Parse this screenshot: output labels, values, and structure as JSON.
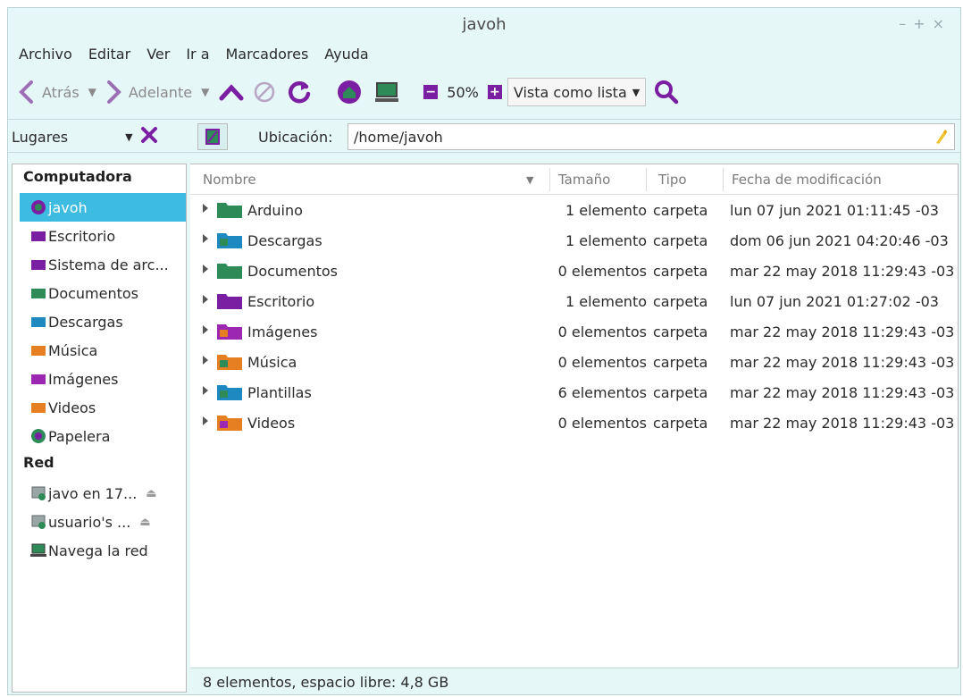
{
  "window": {
    "title": "javoh",
    "controls": [
      "–",
      "+",
      "×"
    ]
  },
  "menu": [
    "Archivo",
    "Editar",
    "Ver",
    "Ir a",
    "Marcadores",
    "Ayuda"
  ],
  "toolbar": {
    "back_label": "Atrás",
    "forward_label": "Adelante",
    "zoom_level": "50%",
    "view_mode": "Vista como lista"
  },
  "location": {
    "places_label": "Lugares",
    "label": "Ubicación:",
    "path": "/home/javoh"
  },
  "sidebar": {
    "section_computer": "Computadora",
    "computer_items": [
      {
        "label": "javoh",
        "icon": "home-folder-icon",
        "color": "#2e8b57"
      },
      {
        "label": "Escritorio",
        "icon": "desktop-folder-icon",
        "color": "#7b1fa2"
      },
      {
        "label": "Sistema de arc...",
        "icon": "filesystem-icon",
        "color": "#7b1fa2"
      },
      {
        "label": "Documentos",
        "icon": "documents-folder-icon",
        "color": "#2e8b57"
      },
      {
        "label": "Descargas",
        "icon": "downloads-folder-icon",
        "color": "#1e88c0"
      },
      {
        "label": "Música",
        "icon": "music-folder-icon",
        "color": "#e67e22"
      },
      {
        "label": "Imágenes",
        "icon": "pictures-folder-icon",
        "color": "#9c27b0"
      },
      {
        "label": "Videos",
        "icon": "videos-folder-icon",
        "color": "#e67e22"
      },
      {
        "label": "Papelera",
        "icon": "trash-icon",
        "color": "#2e8b57"
      }
    ],
    "section_network": "Red",
    "network_items": [
      {
        "label": "javo en 17...",
        "icon": "network-share-icon",
        "eject": true
      },
      {
        "label": "usuario's ...",
        "icon": "network-share-icon",
        "eject": true
      },
      {
        "label": "Navega la red",
        "icon": "network-browse-icon",
        "eject": false
      }
    ]
  },
  "columns": {
    "name": "Nombre",
    "size": "Tamaño",
    "type": "Tipo",
    "date": "Fecha de modificación"
  },
  "files": [
    {
      "name": "Arduino",
      "size": "1 elemento",
      "type": "carpeta",
      "date": "lun 07 jun 2021 01:11:45 -03",
      "color": "#2e8b57",
      "accent": ""
    },
    {
      "name": "Descargas",
      "size": "1 elemento",
      "type": "carpeta",
      "date": "dom 06 jun 2021 04:20:46 -03",
      "color": "#1e88c0",
      "accent": "#2e8b57"
    },
    {
      "name": "Documentos",
      "size": "0 elementos",
      "type": "carpeta",
      "date": "mar 22 may 2018 11:29:43 -03",
      "color": "#2e8b57",
      "accent": ""
    },
    {
      "name": "Escritorio",
      "size": "1 elemento",
      "type": "carpeta",
      "date": "lun 07 jun 2021 01:27:02 -03",
      "color": "#7b1fa2",
      "accent": ""
    },
    {
      "name": "Imágenes",
      "size": "0 elementos",
      "type": "carpeta",
      "date": "mar 22 may 2018 11:29:43 -03",
      "color": "#9c27b0",
      "accent": "#e67e22"
    },
    {
      "name": "Música",
      "size": "0 elementos",
      "type": "carpeta",
      "date": "mar 22 may 2018 11:29:43 -03",
      "color": "#e67e22",
      "accent": "#2e8b57"
    },
    {
      "name": "Plantillas",
      "size": "6 elementos",
      "type": "carpeta",
      "date": "mar 22 may 2018 11:29:43 -03",
      "color": "#1e88c0",
      "accent": "#2e8b57"
    },
    {
      "name": "Videos",
      "size": "0 elementos",
      "type": "carpeta",
      "date": "mar 22 may 2018 11:29:43 -03",
      "color": "#e67e22",
      "accent": "#9c27b0"
    }
  ],
  "status": "8 elementos, espacio libre: 4,8 GB",
  "colors": {
    "accent": "#7b1fa2",
    "selection": "#3dbbe0",
    "background": "#e6f7f8"
  }
}
